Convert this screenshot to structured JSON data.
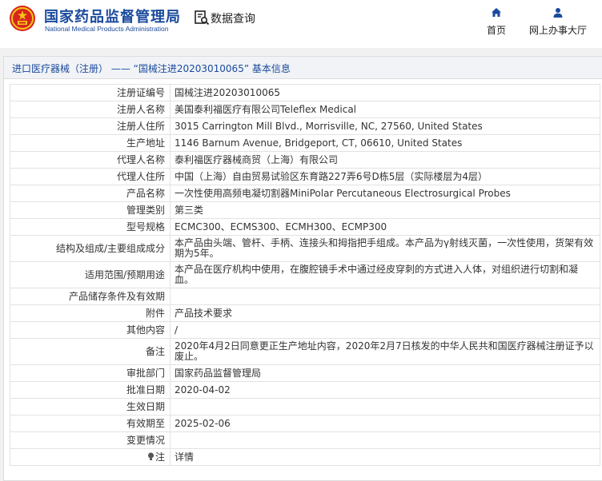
{
  "header": {
    "site_name_cn": "国家药品监督管理局",
    "site_name_en": "National Medical Products Administration",
    "query_title": "数据查询",
    "nav": [
      {
        "label": "首页",
        "icon": "home-icon"
      },
      {
        "label": "网上办事大厅",
        "icon": "user-icon"
      }
    ],
    "accent_color": "#1a4a9c"
  },
  "record": {
    "title": "进口医疗器械（注册） —— “国械注进20203010065” 基本信息",
    "rows": [
      {
        "label": "注册证编号",
        "value": "国械注进20203010065"
      },
      {
        "label": "注册人名称",
        "value": "美国泰利福医疗有限公司Teleflex Medical"
      },
      {
        "label": "注册人住所",
        "value": "3015 Carrington Mill Blvd., Morrisville, NC, 27560, United States"
      },
      {
        "label": "生产地址",
        "value": "1146 Barnum Avenue, Bridgeport, CT, 06610, United States"
      },
      {
        "label": "代理人名称",
        "value": "泰利福医疗器械商贸（上海）有限公司"
      },
      {
        "label": "代理人住所",
        "value": "中国（上海）自由贸易试验区东育路227弄6号D栋5层（实际楼层为4层）"
      },
      {
        "label": "产品名称",
        "value": "一次性使用高频电凝切割器MiniPolar Percutaneous Electrosurgical Probes"
      },
      {
        "label": "管理类别",
        "value": "第三类"
      },
      {
        "label": "型号规格",
        "value": "ECMC300、ECMS300、ECMH300、ECMP300"
      },
      {
        "label": "结构及组成/主要组成成分",
        "value": "本产品由头端、管杆、手柄、连接头和拇指把手组成。本产品为γ射线灭菌，一次性使用，货架有效期为5年。"
      },
      {
        "label": "适用范围/预期用途",
        "value": "本产品在医疗机构中使用，在腹腔镜手术中通过经皮穿刺的方式进入人体，对组织进行切割和凝血。"
      },
      {
        "label": "产品储存条件及有效期",
        "value": ""
      },
      {
        "label": "附件",
        "value": "产品技术要求"
      },
      {
        "label": "其他内容",
        "value": "/"
      },
      {
        "label": "备注",
        "value": "2020年4月2日同意更正生产地址内容，2020年2月7日核发的中华人民共和国医疗器械注册证予以废止。"
      },
      {
        "label": "审批部门",
        "value": "国家药品监督管理局"
      },
      {
        "label": "批准日期",
        "value": "2020-04-02"
      },
      {
        "label": "生效日期",
        "value": ""
      },
      {
        "label": "有效期至",
        "value": "2025-02-06"
      },
      {
        "label": "变更情况",
        "value": ""
      },
      {
        "label": "注",
        "value": "详情",
        "icon": "lightbulb-icon"
      }
    ]
  }
}
